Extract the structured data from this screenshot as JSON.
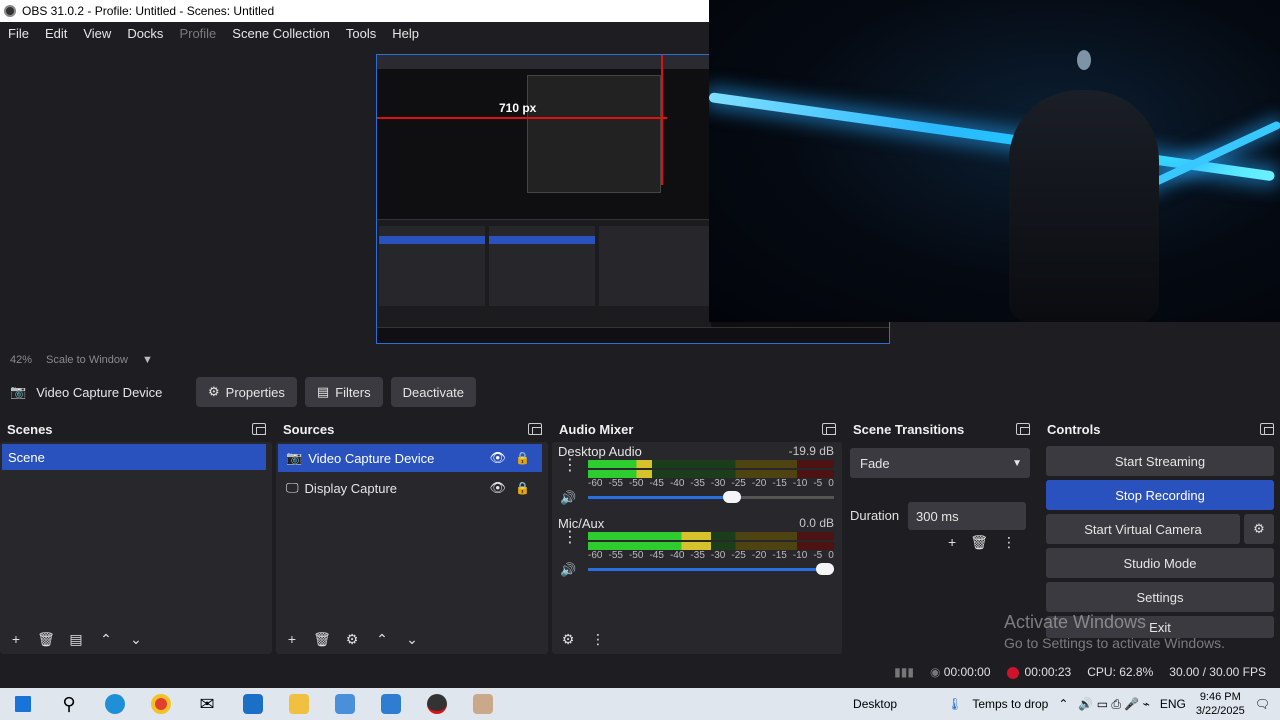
{
  "window": {
    "title": "OBS 31.0.2 - Profile: Untitled - Scenes: Untitled"
  },
  "menu": [
    "File",
    "Edit",
    "View",
    "Docks",
    "Profile",
    "Scene Collection",
    "Tools",
    "Help"
  ],
  "preview": {
    "measure_label": "710 px",
    "zoom": "42%",
    "scale_mode": "Scale to Window"
  },
  "source_toolbar": {
    "selected_source": "Video Capture Device",
    "properties": "Properties",
    "filters": "Filters",
    "deactivate": "Deactivate"
  },
  "scenes": {
    "title": "Scenes",
    "items": [
      "Scene"
    ]
  },
  "sources": {
    "title": "Sources",
    "items": [
      "Video Capture Device",
      "Display Capture"
    ]
  },
  "mixer": {
    "title": "Audio Mixer",
    "scale": [
      "-60",
      "-55",
      "-50",
      "-45",
      "-40",
      "-35",
      "-30",
      "-25",
      "-20",
      "-15",
      "-10",
      "-5",
      "0"
    ],
    "channels": [
      {
        "name": "Desktop Audio",
        "db": "-19.9 dB",
        "level": 0.26,
        "volume": 0.62
      },
      {
        "name": "Mic/Aux",
        "db": "0.0 dB",
        "level": 0.5,
        "volume": 1.0
      }
    ]
  },
  "transitions": {
    "title": "Scene Transitions",
    "selected": "Fade",
    "duration_label": "Duration",
    "duration": "300 ms"
  },
  "controls": {
    "title": "Controls",
    "start_streaming": "Start Streaming",
    "stop_recording": "Stop Recording",
    "start_virtual_camera": "Start Virtual Camera",
    "studio_mode": "Studio Mode",
    "settings": "Settings",
    "exit": "Exit"
  },
  "watermark": {
    "line1": "Activate Windows",
    "line2": "Go to Settings to activate Windows."
  },
  "status": {
    "stream_time": "00:00:00",
    "rec_time": "00:00:23",
    "cpu": "CPU: 62.8%",
    "fps": "30.00 / 30.00 FPS"
  },
  "taskbar": {
    "desktop_label": "Desktop",
    "weather": "Temps to drop",
    "lang": "ENG",
    "time": "9:46 PM",
    "date": "3/22/2025"
  },
  "colors": {
    "accent": "#2a52be",
    "record": "#d1122b",
    "panel": "#27272c",
    "background": "#1e1e22"
  }
}
